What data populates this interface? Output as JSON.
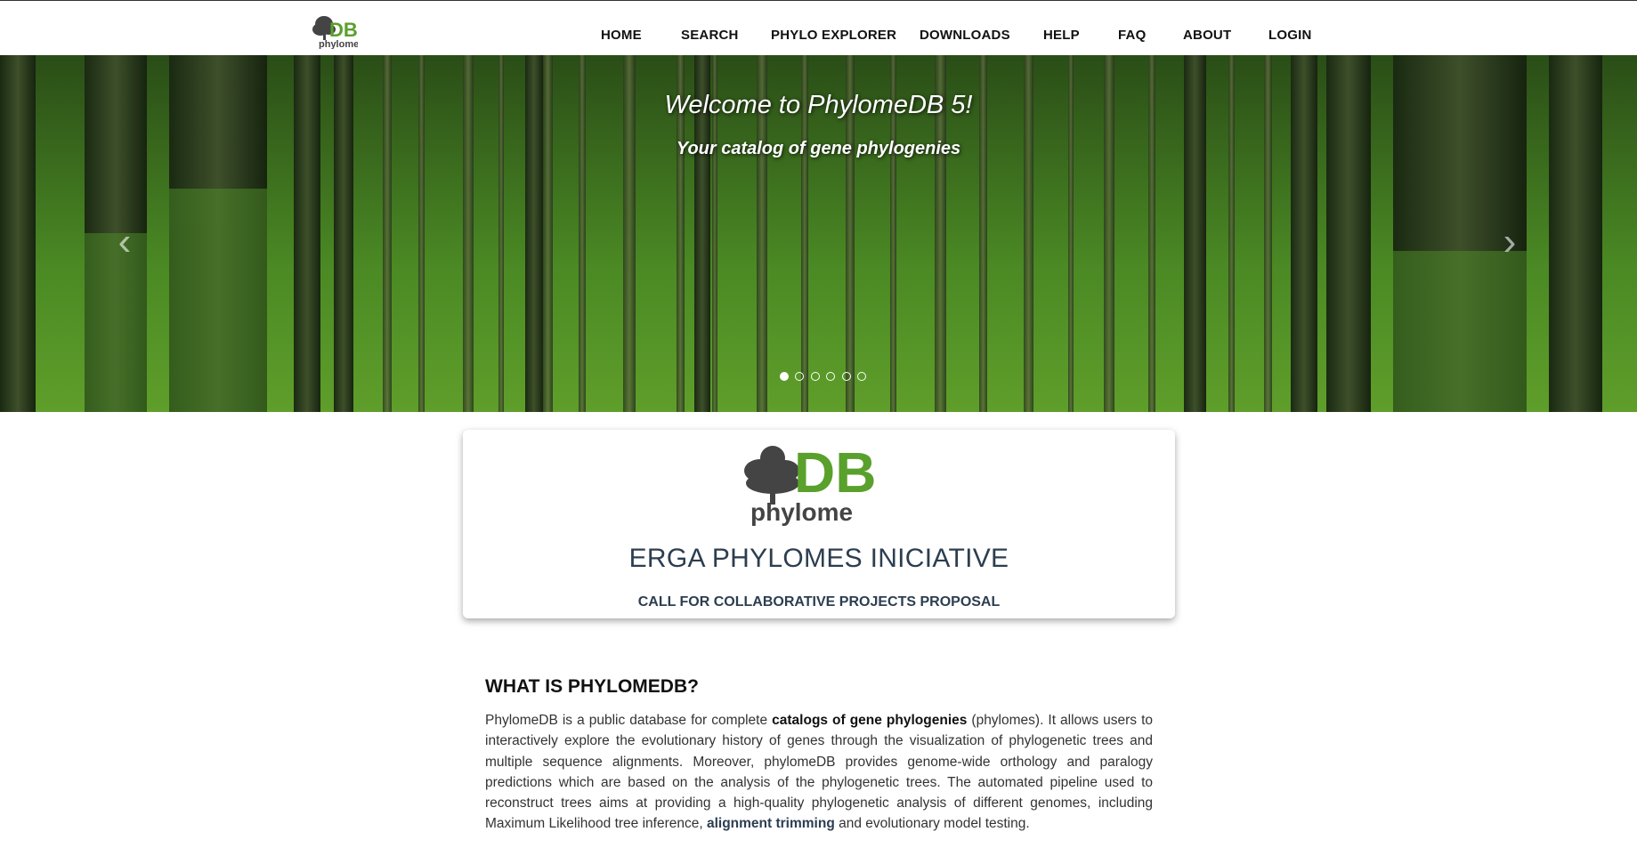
{
  "header": {
    "logo_text": "DB",
    "logo_sub": "phylome",
    "nav": [
      "HOME",
      "SEARCH",
      "PHYLO EXPLORER",
      "DOWNLOADS",
      "HELP",
      "FAQ",
      "ABOUT",
      "LOGIN"
    ]
  },
  "hero": {
    "title": "Welcome to PhylomeDB 5!",
    "subtitle": "Your catalog of gene phylogenies",
    "prev_icon": "chevron-left-icon",
    "next_icon": "chevron-right-icon",
    "slides": 6,
    "active_slide": 1
  },
  "card": {
    "logo_text": "DB",
    "logo_sub": "phylome",
    "title": "ERGA PHYLOMES INICIATIVE",
    "subtitle": "CALL FOR COLLABORATIVE PROJECTS PROPOSAL"
  },
  "about": {
    "heading": "WHAT IS PHYLOMEDB?",
    "p1": "PhylomeDB is a public database for complete ",
    "bold1": "catalogs of gene phylogenies",
    "p2": " (phylomes). It allows users to interactively explore the evolutionary history of genes through the visualization of phylogenetic trees and multiple sequence alignments. Moreover, phylomeDB provides genome-wide orthology and paralogy predictions which are based on the analysis of the phylogenetic trees. The automated pipeline used to reconstruct trees aims at providing a high-quality phylogenetic analysis of different genomes, including Maximum Likelihood tree inference, ",
    "link1": "alignment trimming",
    "p3": " and evolutionary model testing."
  },
  "colors": {
    "logo_green": "#5aa02c",
    "logo_gray": "#444444",
    "title_blue": "#2c3e50"
  }
}
